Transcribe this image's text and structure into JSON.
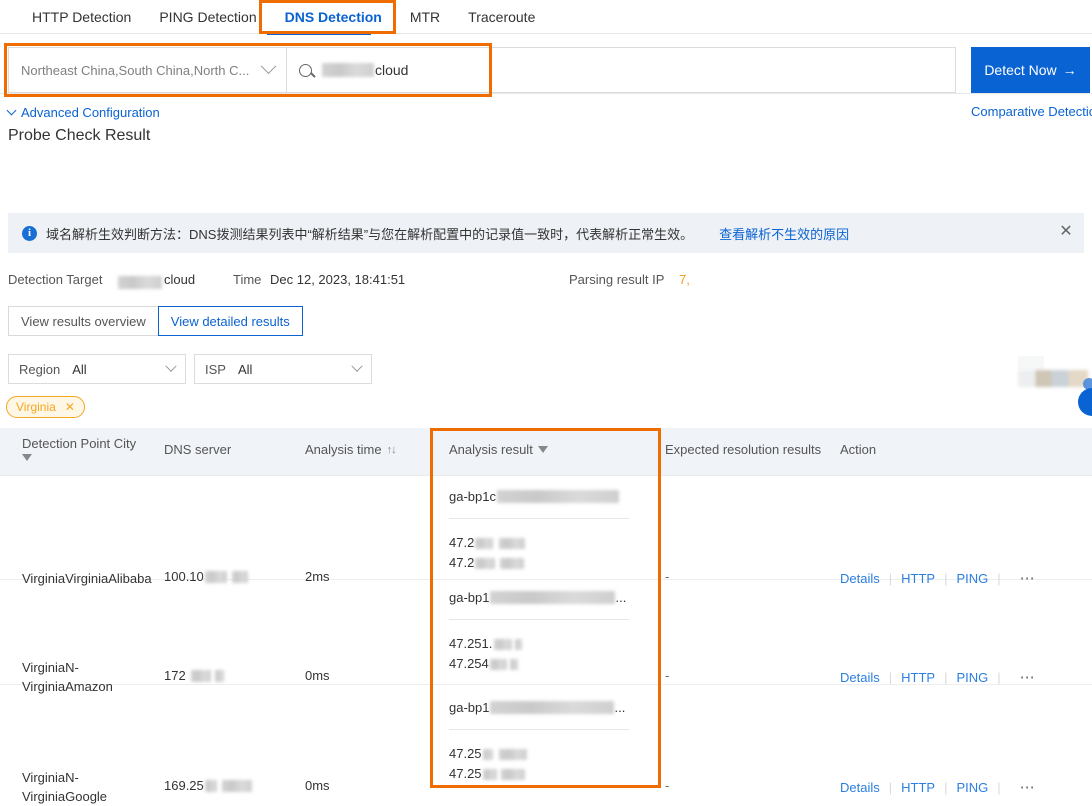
{
  "tabs": [
    {
      "label": "HTTP Detection",
      "active": false
    },
    {
      "label": "PING Detection",
      "active": false
    },
    {
      "label": "DNS Detection",
      "active": true
    },
    {
      "label": "MTR",
      "active": false
    },
    {
      "label": "Traceroute",
      "active": false
    }
  ],
  "search": {
    "region_value": "Northeast China,South China,North C...",
    "target_suffix": "cloud",
    "detect_button": "Detect Now",
    "detect_arrow": "→",
    "comparative_link": "Comparative Detection",
    "advanced_config": "Advanced Configuration"
  },
  "page_title": "Probe Check Result",
  "banner": {
    "text": "域名解析生效判断方法：DNS拨测结果列表中“解析结果”与您在解析配置中的记录值一致时，代表解析正常生效。",
    "link": "查看解析不生效的原因",
    "info_glyph": "i",
    "close_glyph": "✕"
  },
  "meta": {
    "target_label": "Detection Target",
    "target_value": "cloud",
    "time_label": "Time",
    "time_value": "Dec 12, 2023, 18:41:51",
    "parsing_label": "Parsing result IP",
    "parsing_value": "7,"
  },
  "segmented": {
    "overview": "View results overview",
    "detailed": "View detailed results"
  },
  "filters": {
    "region_label": "Region",
    "region_value": "All",
    "isp_label": "ISP",
    "isp_value": "All",
    "tag": "Virginia",
    "tag_close": "✕"
  },
  "table": {
    "headers": {
      "city": "Detection Point City",
      "dns": "DNS server",
      "time": "Analysis time",
      "time_sort": "↑↓",
      "result": "Analysis result",
      "expected": "Expected resolution results",
      "action": "Action"
    },
    "rows": [
      {
        "city": "VirginiaVirginiaAlibaba",
        "dns": "100.10",
        "time": "2ms",
        "result_host": "ga-bp1c",
        "result_host_ellipsis": "",
        "ips": [
          "47.2",
          "47.2"
        ],
        "expected": "-",
        "actions": [
          "Details",
          "HTTP",
          "PING"
        ],
        "more": "⋯"
      },
      {
        "city": "VirginiaN-VirginiaAmazon",
        "dns": "172",
        "time": "0ms",
        "result_host": "ga-bp1",
        "result_host_ellipsis": "...",
        "ips": [
          "47.251.",
          "47.254"
        ],
        "expected": "-",
        "actions": [
          "Details",
          "HTTP",
          "PING"
        ],
        "more": "⋯"
      },
      {
        "city": "VirginiaN-VirginiaGoogle",
        "dns": "169.25",
        "time": "0ms",
        "result_host": "ga-bp1",
        "result_host_ellipsis": "...",
        "ips": [
          "47.25",
          "47.25"
        ],
        "expected": "-",
        "actions": [
          "Details",
          "HTTP",
          "PING"
        ],
        "more": "⋯"
      }
    ]
  },
  "colors": {
    "accent_blue": "#0a63d2",
    "highlight_orange": "#ef6c00",
    "tag_orange": "#f5a623",
    "banner_bg": "#eef1f6",
    "header_bg": "#f0f3f7"
  }
}
